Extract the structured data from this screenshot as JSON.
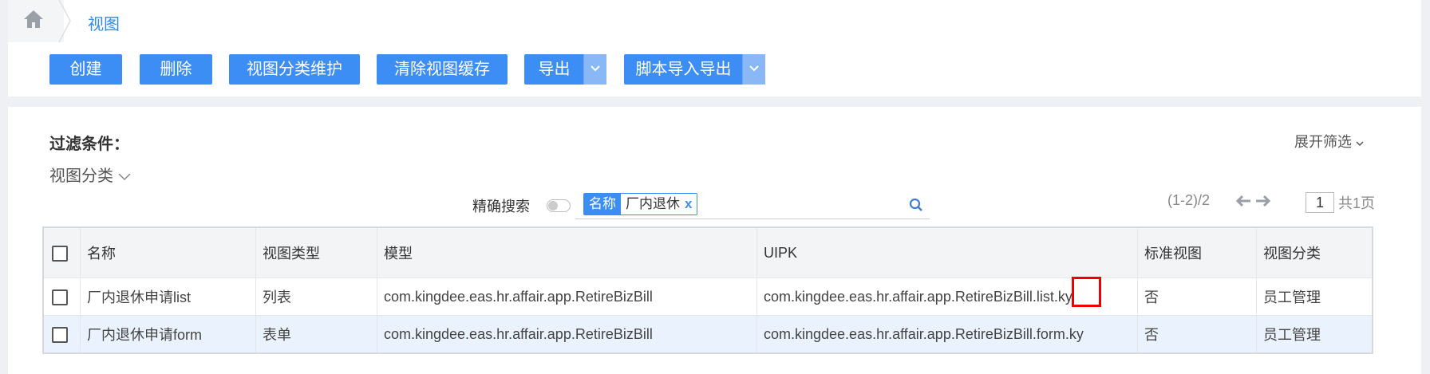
{
  "breadcrumb": {
    "title": "视图"
  },
  "toolbar": {
    "create": "创建",
    "delete": "删除",
    "category_maint": "视图分类维护",
    "clear_cache": "清除视图缓存",
    "export": "导出",
    "script_import_export": "脚本导入导出"
  },
  "filter": {
    "title": "过滤条件：",
    "expand": "展开筛选",
    "view_category": "视图分类",
    "exact_search": "精确搜索",
    "tag_key": "名称",
    "tag_value": "厂内退休",
    "tag_remove": "x"
  },
  "pager": {
    "range": "(1-2)/2",
    "page": "1",
    "total": "共1页"
  },
  "table": {
    "headers": [
      "名称",
      "视图类型",
      "模型",
      "UIPK",
      "标准视图",
      "视图分类"
    ],
    "rows": [
      [
        "厂内退休申请list",
        "列表",
        "com.kingdee.eas.hr.affair.app.RetireBizBill",
        "com.kingdee.eas.hr.affair.app.RetireBizBill.list.ky",
        "否",
        "员工管理"
      ],
      [
        "厂内退休申请form",
        "表单",
        "com.kingdee.eas.hr.affair.app.RetireBizBill",
        "com.kingdee.eas.hr.affair.app.RetireBizBill.form.ky",
        "否",
        "员工管理"
      ]
    ]
  },
  "colors": {
    "accent": "#3d8ef4",
    "highlight": "#e00000"
  }
}
